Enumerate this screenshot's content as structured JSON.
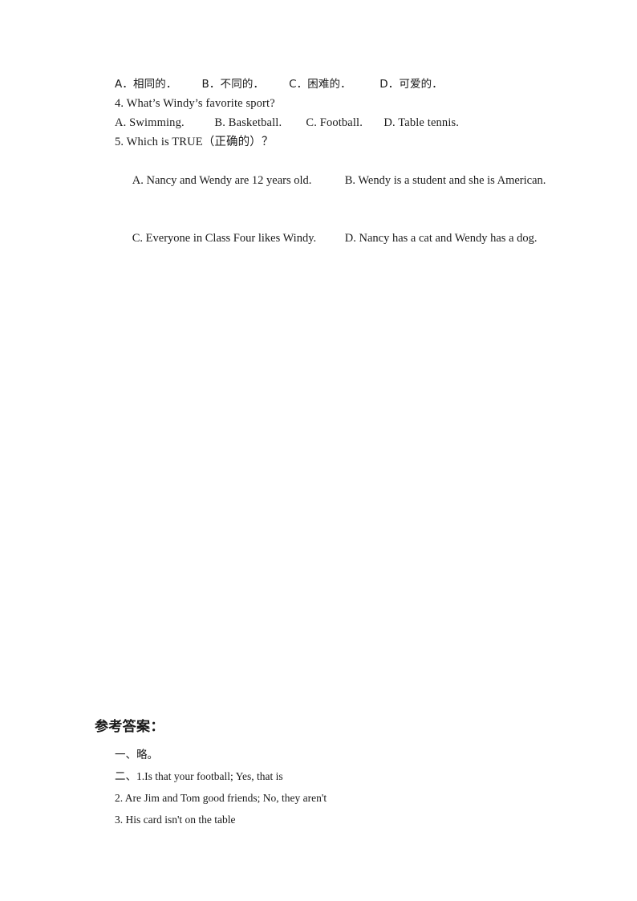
{
  "document": {
    "page_background": "#ffffff",
    "text_color": "#1a1a1a"
  },
  "questions": {
    "q3_options_line": "A．相同的．       B．不同的．       C．困难的．        D．可爱的．",
    "q4_stem": "4. What’s Windy’s favorite sport?",
    "q4_options_line": "A. Swimming.          B. Basketball.        C. Football.       D. Table tennis.",
    "q5_stem": "5. Which is TRUE（正确的）？",
    "q5_option_a": "A. Nancy and Wendy are 12 years old.",
    "q5_option_b": "B. Wendy is a student and she is American.",
    "q5_option_c": "C. Everyone in Class Four likes Windy.",
    "q5_option_d": "D. Nancy has a cat and Wendy has a dog."
  },
  "answer_key": {
    "title": "参考答案：",
    "line_1": "一、略。",
    "line_2": "二、1.Is that your football; Yes, that is",
    "line_3": "2. Are Jim and Tom good friends; No, they aren't",
    "line_4": "3. His card isn't on the table"
  }
}
